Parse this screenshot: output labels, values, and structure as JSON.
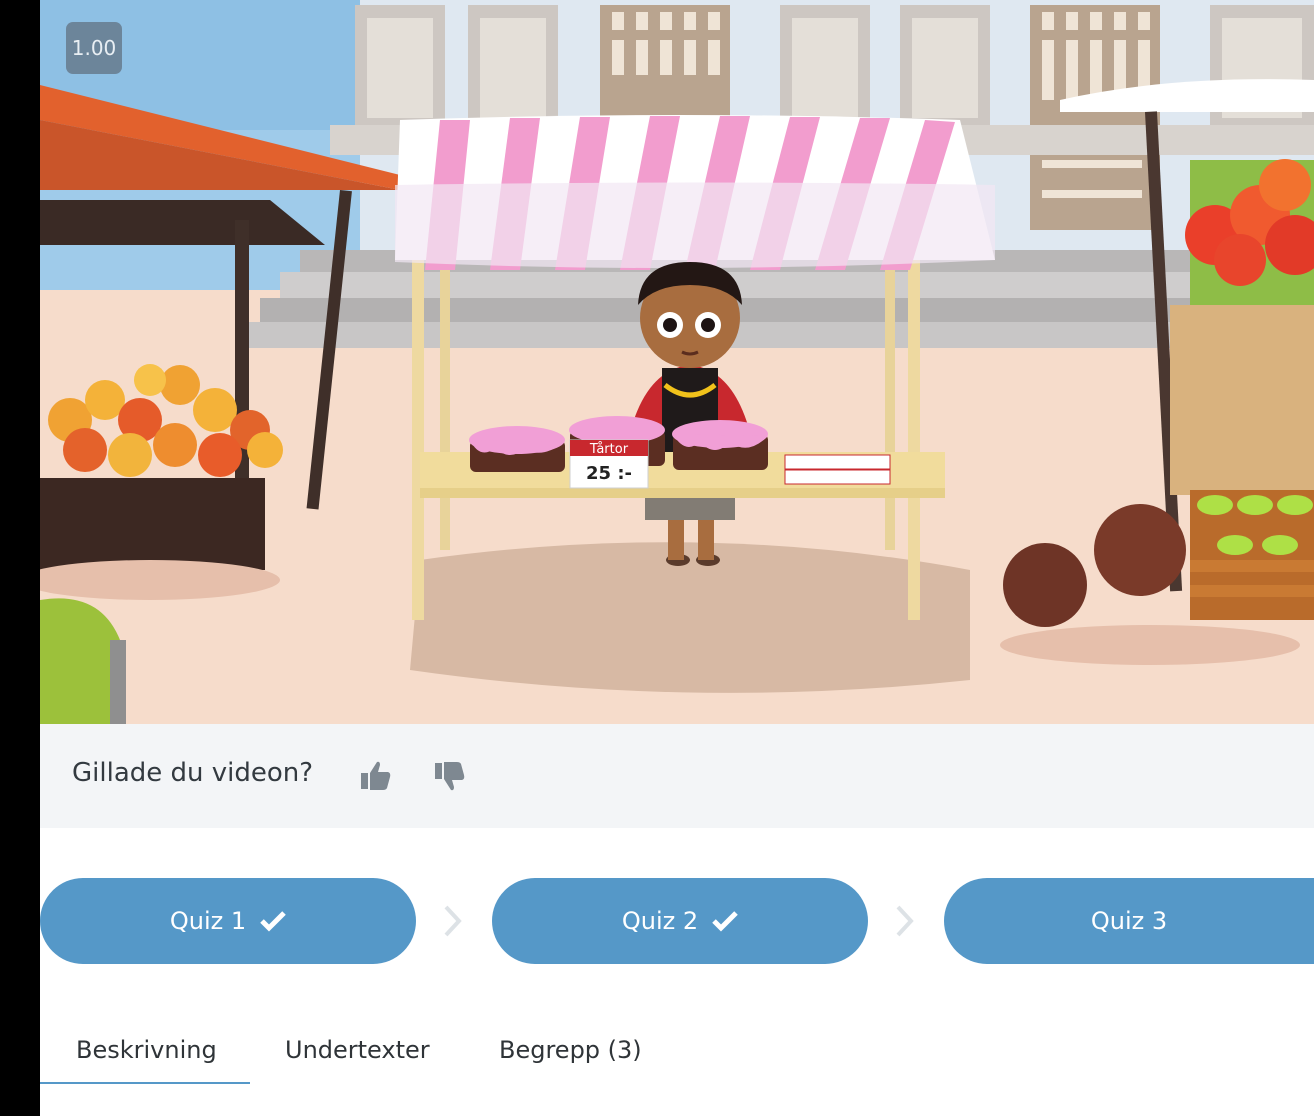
{
  "video": {
    "playback_speed": "1.00",
    "scene": {
      "sign_title": "Tårtor",
      "sign_price": "25 :-"
    }
  },
  "feedback": {
    "question": "Gillade du videon?",
    "like_icon": "thumbs-up-icon",
    "dislike_icon": "thumbs-down-icon"
  },
  "quizzes": [
    {
      "label": "Quiz 1",
      "completed": true
    },
    {
      "label": "Quiz 2",
      "completed": true
    },
    {
      "label": "Quiz 3",
      "completed": false
    }
  ],
  "tabs": [
    {
      "label": "Beskrivning",
      "active": true
    },
    {
      "label": "Undertexter",
      "active": false
    },
    {
      "label": "Begrepp (3)",
      "active": false
    }
  ],
  "colors": {
    "accent": "#5598c8",
    "feedback_bg": "#f3f5f7",
    "text": "#2f3438"
  }
}
